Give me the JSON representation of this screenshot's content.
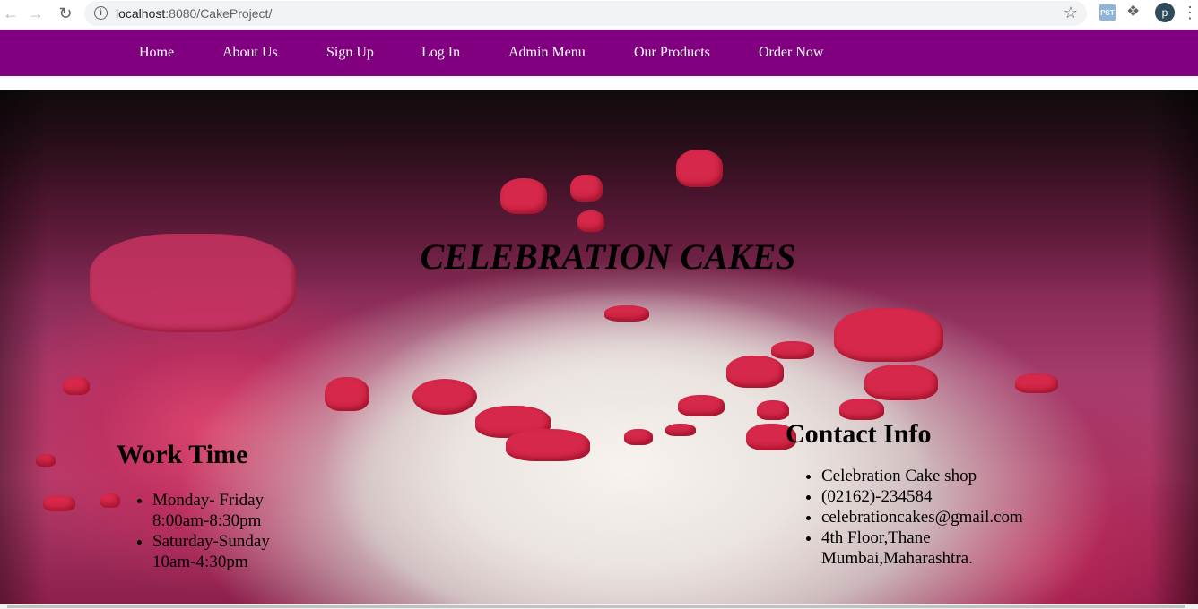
{
  "browser": {
    "url_host": "localhost",
    "url_rest": ":8080/CakeProject/",
    "profile_initial": "p",
    "extension_label": "PST"
  },
  "nav": {
    "items": [
      "Home",
      "About Us",
      "Sign Up",
      "Log In",
      "Admin Menu",
      "Our Products",
      "Order Now"
    ]
  },
  "hero": {
    "title": "CELEBRATION CAKES"
  },
  "work_time": {
    "heading": "Work Time",
    "items": [
      "Monday- Friday 8:00am-8:30pm",
      "Saturday-Sunday 10am-4:30pm"
    ]
  },
  "contact": {
    "heading": "Contact Info",
    "items": [
      "Celebration Cake shop",
      "(02162)-234584",
      "celebrationcakes@gmail.com",
      "4th Floor,Thane Mumbai,Maharashtra."
    ]
  },
  "colors": {
    "nav_background": "#800080",
    "nav_text": "#ffffff"
  }
}
